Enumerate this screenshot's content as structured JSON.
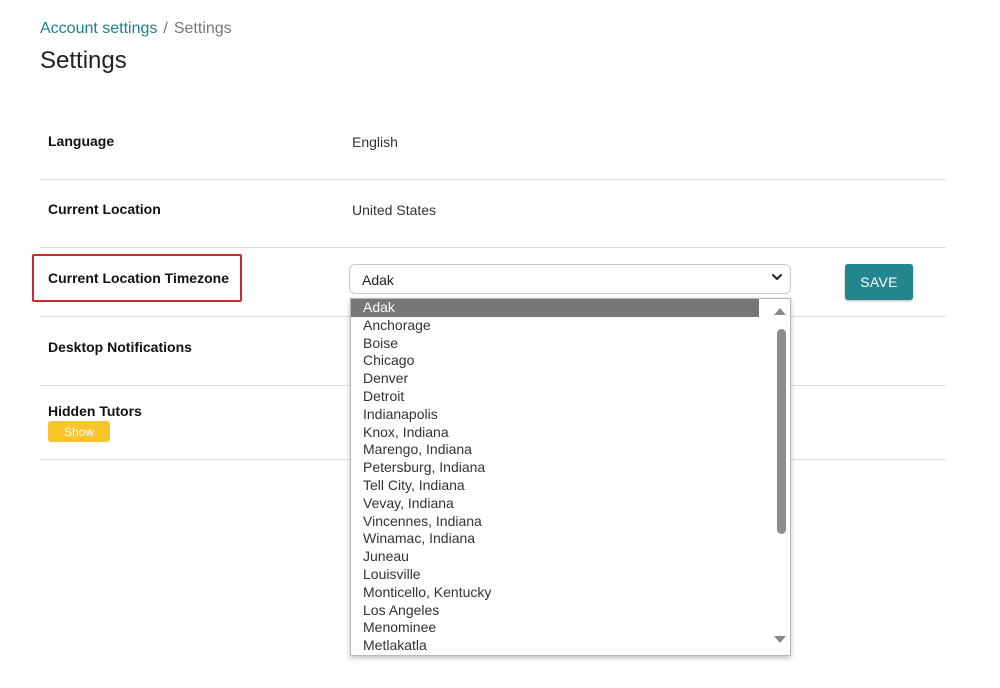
{
  "breadcrumb": {
    "parent": "Account settings",
    "separator": "/",
    "current": "Settings"
  },
  "page_title": "Settings",
  "rows": {
    "language": {
      "label": "Language",
      "value": "English"
    },
    "current_location": {
      "label": "Current Location",
      "value": "United States"
    },
    "timezone": {
      "label": "Current Location Timezone",
      "selected": "Adak"
    },
    "desktop_notifications": {
      "label": "Desktop Notifications"
    },
    "hidden_tutors": {
      "label": "Hidden Tutors",
      "show_label": "Show"
    }
  },
  "save_label": "SAVE",
  "timezone_options": [
    "Adak",
    "Anchorage",
    "Boise",
    "Chicago",
    "Denver",
    "Detroit",
    "Indianapolis",
    "Knox, Indiana",
    "Marengo, Indiana",
    "Petersburg, Indiana",
    "Tell City, Indiana",
    "Vevay, Indiana",
    "Vincennes, Indiana",
    "Winamac, Indiana",
    "Juneau",
    "Louisville",
    "Monticello, Kentucky",
    "Los Angeles",
    "Menominee",
    "Metlakatla"
  ],
  "colors": {
    "accent": "#23868f",
    "link": "#1f7f8c",
    "show_button": "#f8c52b",
    "highlight_box": "#d52828",
    "selected_option": "#777777"
  }
}
